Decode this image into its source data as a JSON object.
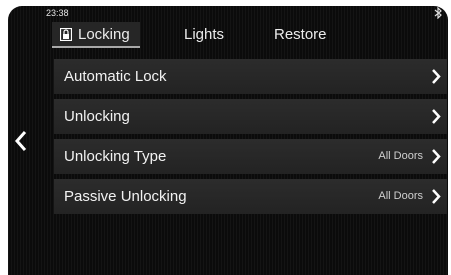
{
  "status_bar": {
    "time": "23:38",
    "bluetooth_icon": "bluetooth-icon"
  },
  "tabs": [
    {
      "label": "Locking",
      "icon": "lock-icon",
      "active": true
    },
    {
      "label": "Lights",
      "active": false
    },
    {
      "label": "Restore",
      "active": false
    }
  ],
  "back_icon": "chevron-left-icon",
  "rows": [
    {
      "label": "Automatic Lock",
      "value": ""
    },
    {
      "label": "Unlocking",
      "value": ""
    },
    {
      "label": "Unlocking Type",
      "value": "All Doors"
    },
    {
      "label": "Passive Unlocking",
      "value": "All Doors"
    }
  ],
  "colors": {
    "background": "#0b0b0b",
    "row": "#262626",
    "text": "#ffffff"
  }
}
